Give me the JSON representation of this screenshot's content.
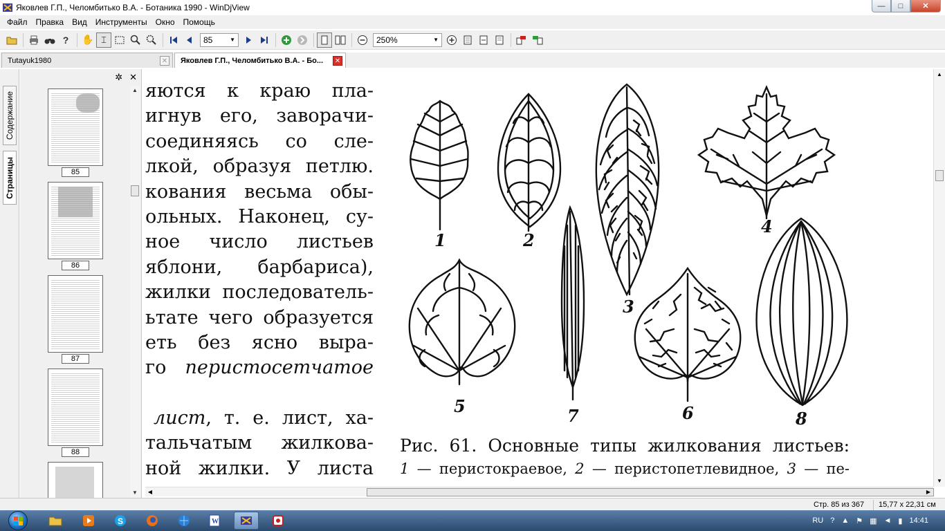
{
  "window": {
    "title": "Яковлев Г.П., Челомбитько В.А. -  Ботаника 1990 - WinDjView",
    "buttons": {
      "minimize": "—",
      "maximize": "□",
      "close": "✕"
    }
  },
  "menu": [
    "Файл",
    "Правка",
    "Вид",
    "Инструменты",
    "Окно",
    "Помощь"
  ],
  "toolbar": {
    "page_number": "85",
    "zoom": "250%"
  },
  "tabs": [
    {
      "label": "Tutayuk1980",
      "close": "✕"
    },
    {
      "label": "Яковлев Г.П., Челомбитько В.А. -  Бо...",
      "close": "✕"
    }
  ],
  "side_tabs": {
    "contents": "Содержание",
    "pages": "Страницы"
  },
  "panel": {
    "settings": "✲",
    "close": "✕"
  },
  "thumbnails": [
    "85",
    "86",
    "87",
    "88"
  ],
  "document": {
    "text_lines": [
      "яются  к  краю  пла-",
      "игнув  его,  заворачи-",
      "  соединяясь  со  сле-",
      "лкой, образуя петлю.",
      "кования  весьма  обы-",
      "ольных.  Наконец,  су-",
      "ное   число   листьев",
      " яблони,  барбариса),",
      "жилки последователь-",
      "ьтате чего образуется",
      "еть  без  ясно  выра-"
    ],
    "line_go_prefix": "го",
    "line_go_italic": "перистосетчатое",
    "line_list_italic": "лист",
    "line_list_rest": ", т. е. лист, ха-",
    "line_palm": "тальчатым   жилкова-",
    "line_last": "ной  жилки.  У  листа",
    "figure_numbers": [
      "1",
      "2",
      "3",
      "4",
      "5",
      "6",
      "7",
      "8"
    ],
    "caption_title": "Рис. 61. Основные типы жилкования листьев:",
    "caption_n1": "1",
    "caption_t1": " — перистокраевое, ",
    "caption_n2": "2",
    "caption_t2": " — перистопетлевидное, ",
    "caption_n3": "3",
    "caption_t3": " — пе-"
  },
  "status": {
    "page": "Стр. 85 из 367",
    "size": "15,77 x 22,31 см"
  },
  "taskbar": {
    "lang": "RU",
    "clock": "14:41"
  }
}
